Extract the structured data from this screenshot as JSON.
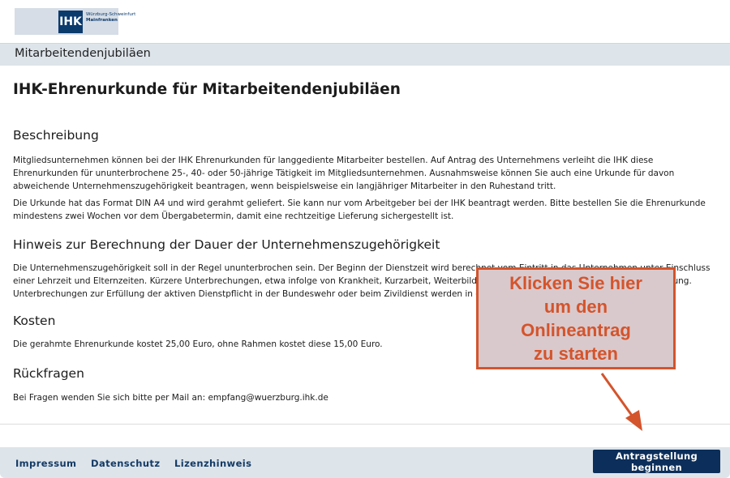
{
  "logo": {
    "text": "IHK",
    "line1": "Würzburg-Schweinfurt",
    "line2": "Mainfranken"
  },
  "section_bar": {
    "title": "Mitarbeitendenjubiläen"
  },
  "main": {
    "title": "IHK-Ehrenurkunde für Mitarbeitendenjubiläen",
    "sections": [
      {
        "heading": "Beschreibung",
        "paragraphs": [
          "Mitgliedsunternehmen können bei der IHK Ehrenurkunden für langgediente Mitarbeiter bestellen. Auf Antrag des Unternehmens verleiht die IHK diese Ehrenurkunden für ununterbrochene 25-, 40- oder 50-jährige Tätigkeit im Mitgliedsunternehmen. Ausnahmsweise können Sie auch eine Urkunde für davon abweichende Unternehmenszugehörigkeit beantragen, wenn beispielsweise ein langjähriger Mitarbeiter in den Ruhestand tritt.",
          "Die Urkunde hat das Format DIN A4 und wird gerahmt geliefert. Sie kann nur vom Arbeitgeber bei der IHK beantragt werden. Bitte bestellen Sie die Ehrenurkunde mindestens zwei Wochen vor dem Übergabetermin, damit eine rechtzeitige Lieferung sichergestellt ist."
        ]
      },
      {
        "heading": "Hinweis zur Berechnung der Dauer der Unternehmenszugehörigkeit",
        "paragraphs": [
          "Die Unternehmenszugehörigkeit soll in der Regel ununterbrochen sein. Der Beginn der Dienstzeit wird berechnet vom Eintritt in das Unternehmen unter Einschluss einer Lehrzeit und Elternzeiten. Kürzere Unterbrechungen, etwa infolge von Krankheit, Kurzarbeit, Weiterbildungsmaßnahmen, gelten nicht als Unterbrechung. Unterbrechungen zur Erfüllung der aktiven Dienstpflicht in der Bundeswehr oder beim Zivildienst werden in die Dienstzeit mit eingerechnet."
        ]
      },
      {
        "heading": "Kosten",
        "paragraphs": [
          "Die gerahmte Ehrenurkunde kostet 25,00 Euro, ohne Rahmen kostet diese 15,00 Euro."
        ]
      },
      {
        "heading": "Rückfragen",
        "paragraphs": [
          "Bei Fragen wenden Sie sich bitte per Mail an: empfang@wuerzburg.ihk.de"
        ]
      }
    ]
  },
  "footer": {
    "links": [
      "Impressum",
      "Datenschutz",
      "Lizenzhinweis"
    ],
    "cta_label": "Antragstellung beginnen"
  },
  "callout": {
    "text": "Klicken Sie hier\num den\nOnlineantrag\nzu starten",
    "color": "#d4542c",
    "background": "#d9c9cc"
  },
  "colors": {
    "brand_navy": "#0c2e5a",
    "bar_gray": "#dde4ea",
    "link": "#133a66"
  }
}
